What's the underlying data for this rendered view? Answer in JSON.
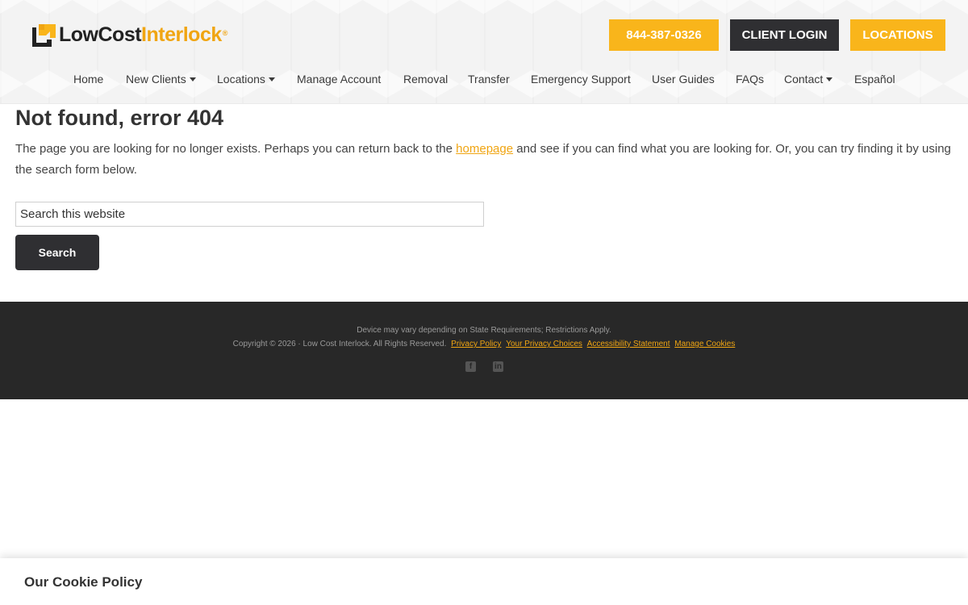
{
  "brand": {
    "logo_low": "LowCost",
    "logo_interlock": "Interlock",
    "logo_reg": "®"
  },
  "header_buttons": {
    "phone": "844-387-0326",
    "login": "CLIENT LOGIN",
    "locations": "LOCATIONS"
  },
  "nav": {
    "items": [
      {
        "label": "Home"
      },
      {
        "label": "New Clients"
      },
      {
        "label": "Locations"
      },
      {
        "label": "Manage Account"
      },
      {
        "label": "Removal"
      },
      {
        "label": "Transfer"
      },
      {
        "label": "Emergency Support"
      },
      {
        "label": "User Guides"
      },
      {
        "label": "FAQs"
      },
      {
        "label": "Contact"
      },
      {
        "label": "Español"
      }
    ]
  },
  "main": {
    "title": "Not found, error 404",
    "intro_before": "The page you are looking for no longer exists. Perhaps you can return back to the ",
    "intro_link": "homepage",
    "intro_after": " and see if you can find what you are looking for. Or, you can try finding it by using the search form below.",
    "search_placeholder": "Search this website",
    "search_button": "Search"
  },
  "footer": {
    "disclaimer": "Device may vary depending on State Requirements; Restrictions Apply.",
    "copyright": "Copyright © 2026 · Low Cost Interlock. All Rights Reserved.",
    "links": [
      "Privacy Policy",
      "Your Privacy Choices",
      "Accessibility Statement",
      "Manage Cookies"
    ],
    "social_icons": [
      "facebook-icon",
      "linkedin-icon"
    ]
  },
  "cookie": {
    "title": "Our Cookie Policy"
  },
  "colors": {
    "accent": "#f9b51b",
    "dark": "#2f2f32",
    "footer_bg": "#282828"
  }
}
